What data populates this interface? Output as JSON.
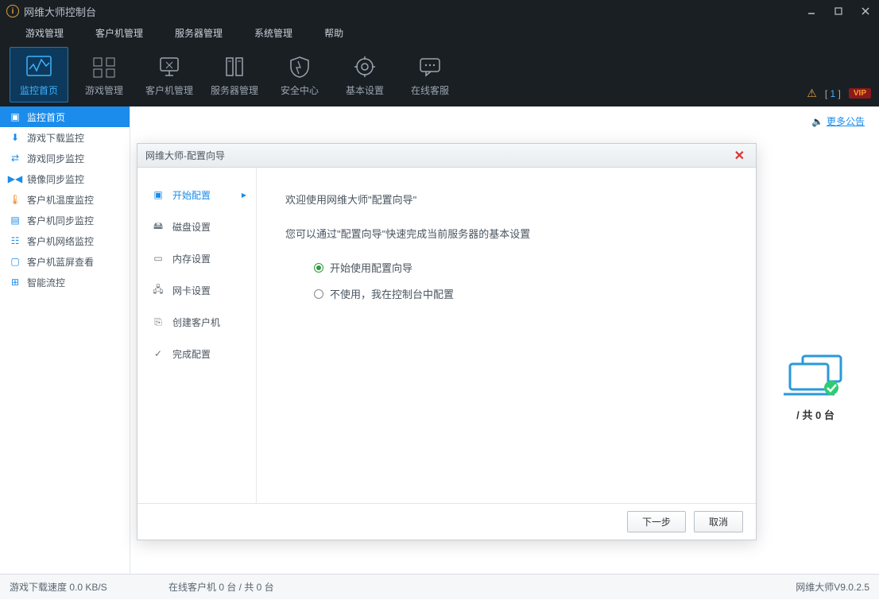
{
  "window": {
    "title": "网维大师控制台"
  },
  "menubar": [
    "游戏管理",
    "客户机管理",
    "服务器管理",
    "系统管理",
    "帮助"
  ],
  "toolbar": {
    "items": [
      {
        "label": "监控首页",
        "icon": "activity",
        "active": true
      },
      {
        "label": "游戏管理",
        "icon": "games",
        "active": false
      },
      {
        "label": "客户机管理",
        "icon": "client",
        "active": false
      },
      {
        "label": "服务器管理",
        "icon": "server",
        "active": false
      },
      {
        "label": "安全中心",
        "icon": "shield",
        "active": false
      },
      {
        "label": "基本设置",
        "icon": "gear",
        "active": false
      },
      {
        "label": "在线客服",
        "icon": "chat",
        "active": false
      }
    ],
    "warn_count": "1",
    "vip_label": "VIP"
  },
  "sidebar": [
    {
      "label": "监控首页",
      "icon": "monitor-home",
      "active": true
    },
    {
      "label": "游戏下载监控",
      "icon": "download",
      "active": false
    },
    {
      "label": "游戏同步监控",
      "icon": "sync",
      "active": false
    },
    {
      "label": "镜像同步监控",
      "icon": "mirror",
      "active": false
    },
    {
      "label": "客户机温度监控",
      "icon": "temperature",
      "active": false
    },
    {
      "label": "客户机同步监控",
      "icon": "client-sync",
      "active": false
    },
    {
      "label": "客户机网络监控",
      "icon": "network",
      "active": false
    },
    {
      "label": "客户机蓝屏查看",
      "icon": "bsod",
      "active": false
    },
    {
      "label": "智能流控",
      "icon": "flow",
      "active": false
    }
  ],
  "more_link": "更多公告",
  "client_illus_text": "/ 共 0 台",
  "dialog": {
    "title": "网维大师-配置向导",
    "nav": [
      "开始配置",
      "磁盘设置",
      "内存设置",
      "网卡设置",
      "创建客户机",
      "完成配置"
    ],
    "welcome_line1": "欢迎使用网维大师\"配置向导\"",
    "welcome_line2": "您可以通过\"配置向导\"快速完成当前服务器的基本设置",
    "radio_opt1": "开始使用配置向导",
    "radio_opt2": "不使用，我在控制台中配置",
    "btn_next": "下一步",
    "btn_cancel": "取消"
  },
  "statusbar": {
    "left": "游戏下载速度 0.0 KB/S",
    "mid": "在线客户机 0 台 / 共 0 台",
    "right": "网维大师V9.0.2.5"
  }
}
